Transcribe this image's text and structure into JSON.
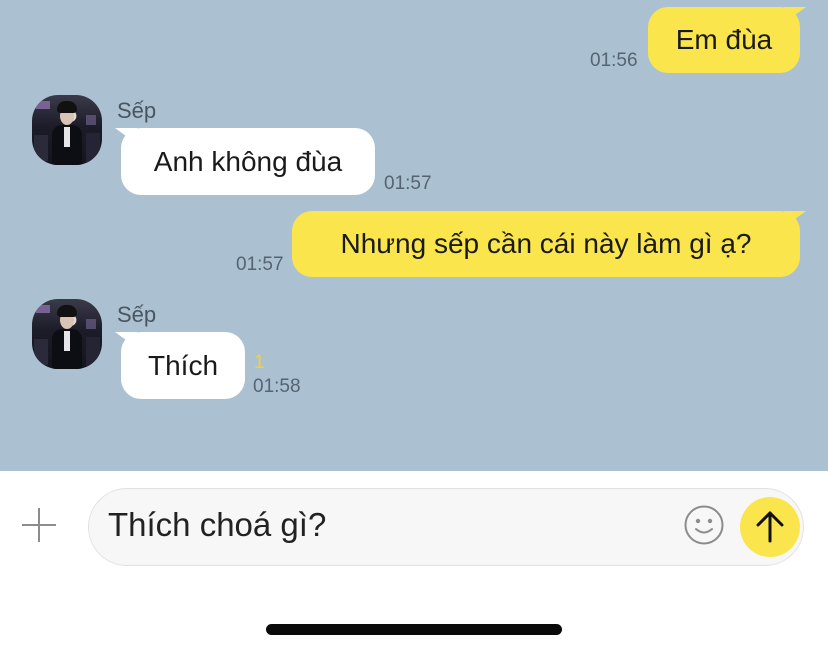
{
  "messages": [
    {
      "direction": "out",
      "text": "Em đùa",
      "time": "01:56"
    },
    {
      "direction": "in",
      "sender": "Sếp",
      "text": "Anh không đùa",
      "time": "01:57"
    },
    {
      "direction": "out",
      "text": "Nhưng sếp cần cái này làm gì ạ?",
      "time": "01:57"
    },
    {
      "direction": "in",
      "sender": "Sếp",
      "text": "Thích",
      "time": "01:58",
      "unread": "1"
    }
  ],
  "composer": {
    "text": "Thích choá gì?",
    "icons": {
      "attach": "plus-icon",
      "emoji": "emoji-icon",
      "send": "arrow-up-icon"
    }
  },
  "colors": {
    "chat_background": "#abc1d1",
    "outgoing_bubble": "#fae64c",
    "incoming_bubble": "#ffffff",
    "send_button": "#fae64c",
    "unread_count": "#f5d22e"
  }
}
